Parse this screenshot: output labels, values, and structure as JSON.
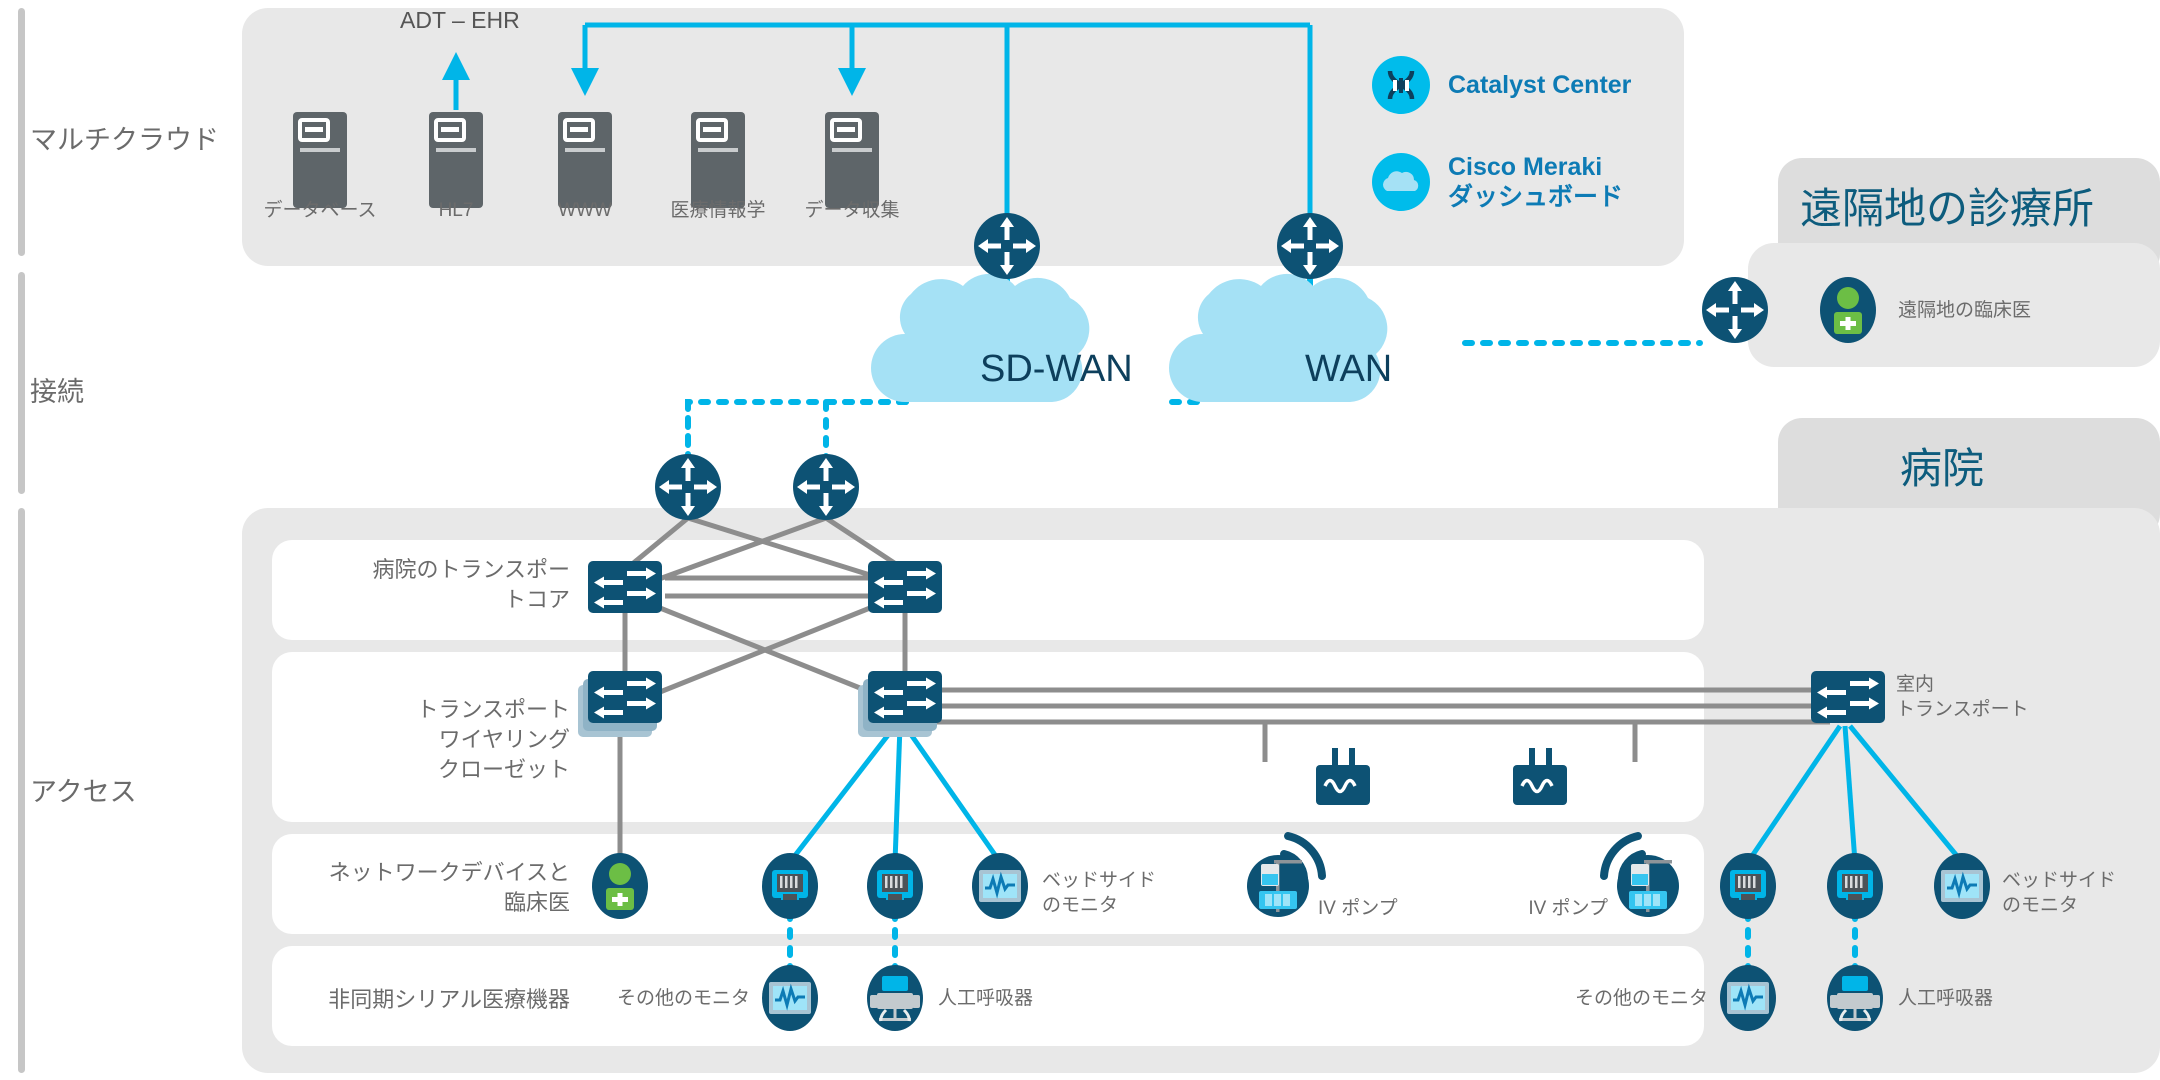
{
  "tiers": [
    {
      "key": "multicloud",
      "label": "マルチクラウド"
    },
    {
      "key": "connectivity",
      "label": "接続"
    },
    {
      "key": "access",
      "label": "アクセス"
    }
  ],
  "multicloud": {
    "flow_label": "ADT – EHR",
    "servers": [
      {
        "name": "database",
        "label": "データベース"
      },
      {
        "name": "hl7",
        "label": "HL7"
      },
      {
        "name": "www",
        "label": "WWW"
      },
      {
        "name": "informatics",
        "label": "医療情報学"
      },
      {
        "name": "data-collection",
        "label": "データ収集"
      }
    ],
    "logos": [
      {
        "name": "catalyst-center",
        "icon": "dna-icon",
        "label": "Catalyst Center"
      },
      {
        "name": "cisco-meraki",
        "icon": "cloud-icon",
        "label": "Cisco Meraki\nダッシュボード"
      }
    ]
  },
  "connectivity": {
    "clouds": [
      {
        "name": "sd-wan",
        "label": "SD-WAN"
      },
      {
        "name": "wan",
        "label": "WAN"
      }
    ]
  },
  "remote_clinic": {
    "title": "遠隔地の診療所",
    "endpoint": {
      "name": "remote-clinician",
      "icon": "clinician-icon",
      "label": "遠隔地の臨床医"
    }
  },
  "hospital": {
    "title": "病院",
    "rows": [
      {
        "name": "hospital-transport-core",
        "label": "病院のトランスポー\nトコア"
      },
      {
        "name": "transport-wiring-closet",
        "label": "トランスポート\nワイヤリング\nクローゼット"
      },
      {
        "name": "network-devices-clinicians",
        "label": "ネットワークデバイスと\n臨床医"
      },
      {
        "name": "async-serial-medical",
        "label": "非同期シリアル医療機器"
      }
    ],
    "in_room_transport": {
      "name": "in-room-transport",
      "label": "室内\nトランスポート"
    },
    "endpoints": {
      "clinician": {
        "label": ""
      },
      "bedside_monitor_left": {
        "label": "ベッドサイド\nのモニタ"
      },
      "bedside_monitor_right": {
        "label": "ベッドサイド\nのモニタ"
      },
      "iv_pump_left": {
        "label": "IV ポンプ"
      },
      "iv_pump_right": {
        "label": "IV ポンプ"
      },
      "other_monitor_left": {
        "label": "その他のモニタ"
      },
      "other_monitor_right": {
        "label": "その他のモニタ"
      },
      "ventilator_left": {
        "label": "人工呼吸器"
      },
      "ventilator_right": {
        "label": "人工呼吸器"
      }
    }
  },
  "colors": {
    "panel": "#e8e8e8",
    "panel_white": "#ffffff",
    "panel_tab": "#dddddd",
    "server": "#5e6569",
    "node_navy": "#0d5274",
    "cyan": "#00b5e8",
    "cloud": "#a5e1f5",
    "link_gray": "#8d8d8d",
    "green": "#6cbe45",
    "brand_blue": "#0d7bb5",
    "title_blue": "#0d5c7d",
    "text_gray": "#6b6b6b"
  }
}
